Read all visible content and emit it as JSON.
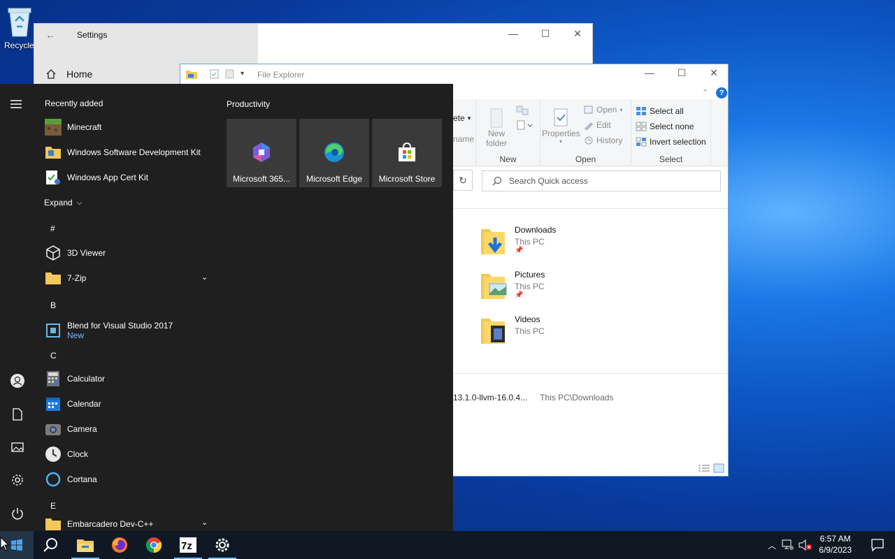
{
  "desktop": {
    "recycle_label": "Recycle"
  },
  "settings": {
    "title": "Settings",
    "home": "Home"
  },
  "explorer": {
    "title": "File Explorer",
    "ribbon": {
      "partial_delete": "ete",
      "partial_rename": "name",
      "new_folder_line1": "New",
      "new_folder_line2": "folder",
      "group_new": "New",
      "properties": "Properties",
      "open": "Open",
      "edit": "Edit",
      "history": "History",
      "group_open": "Open",
      "select_all": "Select all",
      "select_none": "Select none",
      "invert_selection": "Invert selection",
      "group_select": "Select"
    },
    "search_placeholder": "Search Quick access",
    "quick_access": [
      {
        "name": "Downloads",
        "location": "This PC"
      },
      {
        "name": "Pictures",
        "location": "This PC"
      },
      {
        "name": "Videos",
        "location": "This PC"
      }
    ],
    "recent_file": {
      "name": "13.1.0-llvm-16.0.4...",
      "path": "This PC\\Downloads"
    }
  },
  "start_menu": {
    "recently_added_label": "Recently added",
    "recent_apps": [
      "Minecraft",
      "Windows Software Development Kit",
      "Windows App Cert Kit"
    ],
    "expand_label": "Expand",
    "sections": [
      {
        "letter": "#",
        "apps": [
          "3D Viewer",
          "7-Zip"
        ]
      },
      {
        "letter": "B",
        "apps": [
          "Blend for Visual Studio 2017"
        ]
      },
      {
        "letter": "C",
        "apps": [
          "Calculator",
          "Calendar",
          "Camera",
          "Clock",
          "Cortana"
        ]
      },
      {
        "letter": "E",
        "apps": [
          "Embarcadero Dev-C++"
        ]
      }
    ],
    "new_badge": "New",
    "tiles_group": "Productivity",
    "tiles": [
      "Microsoft 365...",
      "Microsoft Edge",
      "Microsoft Store"
    ]
  },
  "taskbar": {
    "time": "6:57 AM",
    "date": "6/9/2023",
    "pinned": [
      "file-explorer",
      "firefox",
      "chrome",
      "7-zip",
      "settings"
    ]
  },
  "colors": {
    "accent": "#76b9ed",
    "start_bg": "#1f1f1f",
    "new_badge": "#7ab7ff"
  }
}
